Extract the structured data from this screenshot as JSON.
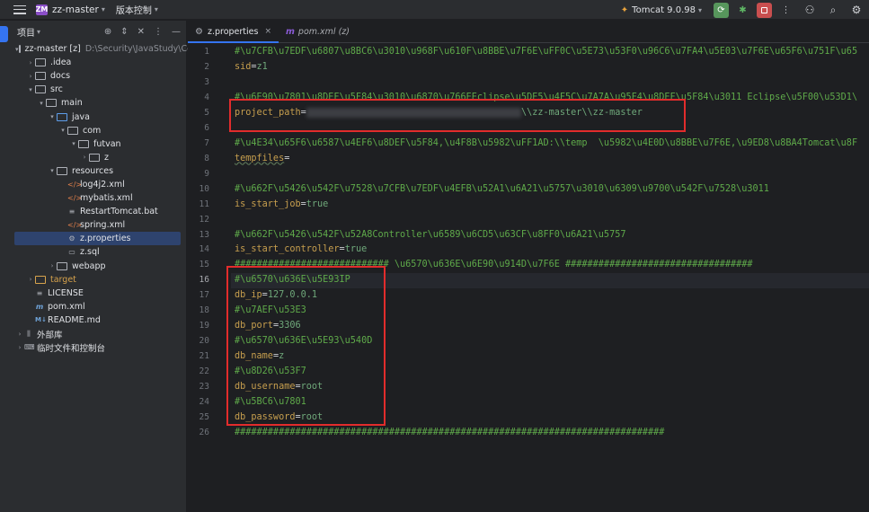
{
  "titlebar": {
    "project_badge": "ZM",
    "project_name": "zz-master",
    "vcs_label": "版本控制",
    "run_config": "Tomcat 9.0.98",
    "icons": [
      "menu-icon",
      "run-icon",
      "debug-icon",
      "stop-icon",
      "more-icon",
      "add-user-icon",
      "search-icon",
      "settings-icon"
    ]
  },
  "project_panel": {
    "title": "项目",
    "tree": [
      {
        "label": "zz-master [z]",
        "extra": "D:\\Security\\JavaStudy\\Code"
      },
      {
        "label": ".idea"
      },
      {
        "label": "docs"
      },
      {
        "label": "src"
      },
      {
        "label": "main"
      },
      {
        "label": "java"
      },
      {
        "label": "com"
      },
      {
        "label": "futvan"
      },
      {
        "label": "z"
      },
      {
        "label": "resources"
      },
      {
        "label": "log4j2.xml"
      },
      {
        "label": "mybatis.xml"
      },
      {
        "label": "RestartTomcat.bat"
      },
      {
        "label": "spring.xml"
      },
      {
        "label": "z.properties"
      },
      {
        "label": "z.sql"
      },
      {
        "label": "webapp"
      },
      {
        "label": "target"
      },
      {
        "label": "LICENSE"
      },
      {
        "label": "pom.xml"
      },
      {
        "label": "README.md"
      },
      {
        "label": "外部库"
      },
      {
        "label": "临时文件和控制台"
      }
    ]
  },
  "tabs": [
    {
      "label": "z.properties"
    },
    {
      "label": "pom.xml (z)"
    }
  ],
  "editor": {
    "lines": [
      {
        "n": "1",
        "parts": [
          {
            "t": "#\\u7CFB\\u7EDF\\u6807\\u8BC6\\u3010\\u968F\\u610F\\u8BBE\\u7F6E\\uFF0C\\u5E73\\u53F0\\u96C6\\u7FA4\\u5E03\\u7F6E\\u65F6\\u751F\\u65",
            "c": "cmt"
          }
        ]
      },
      {
        "n": "2",
        "parts": [
          {
            "t": "sid",
            "c": "key"
          },
          {
            "t": "=",
            "c": "eq"
          },
          {
            "t": "z1",
            "c": "val"
          }
        ]
      },
      {
        "n": "3",
        "parts": []
      },
      {
        "n": "4",
        "parts": [
          {
            "t": "#\\u6E90\\u7801\\u8DEF\\u5F84\\u3010\\u6870\\u766EEclipse\\u5DE5\\u4F5C\\u7A7A\\u95F4\\u8DEF\\u5F84\\u3011 Eclipse\\u5F00\\u53D1\\",
            "c": "cmt"
          }
        ]
      },
      {
        "n": "5",
        "parts": [
          {
            "t": "project_path",
            "c": "key"
          },
          {
            "t": "=",
            "c": "eq"
          },
          {
            "t": "D:\\\\Security\\\\JavaStudy\\\\Code_audit\\\\zz",
            "c": "blur"
          },
          {
            "t": "\\\\zz-master\\\\zz-master",
            "c": "val"
          }
        ]
      },
      {
        "n": "6",
        "parts": []
      },
      {
        "n": "7",
        "parts": [
          {
            "t": "#\\u4E34\\u65F6\\u6587\\u4EF6\\u8DEF\\u5F84,\\u4F8B\\u5982\\uFF1AD:\\\\temp  \\u5982\\u4E0D\\u8BBE\\u7F6E,\\u9ED8\\u8BA4Tomcat\\u8F",
            "c": "cmt"
          }
        ]
      },
      {
        "n": "8",
        "parts": [
          {
            "t": "tempfiles",
            "c": "key spell"
          },
          {
            "t": "=",
            "c": "eq"
          }
        ]
      },
      {
        "n": "9",
        "parts": []
      },
      {
        "n": "10",
        "parts": [
          {
            "t": "#\\u662F\\u5426\\u542F\\u7528\\u7CFB\\u7EDF\\u4EFB\\u52A1\\u6A21\\u5757\\u3010\\u6309\\u9700\\u542F\\u7528\\u3011",
            "c": "cmt"
          }
        ]
      },
      {
        "n": "11",
        "parts": [
          {
            "t": "is_start_job",
            "c": "key"
          },
          {
            "t": "=",
            "c": "eq"
          },
          {
            "t": "true",
            "c": "val"
          }
        ]
      },
      {
        "n": "12",
        "parts": []
      },
      {
        "n": "13",
        "parts": [
          {
            "t": "#\\u662F\\u5426\\u542F\\u52A8Controller\\u6589\\u6CD5\\u63CF\\u8FF0\\u6A21\\u5757",
            "c": "cmt"
          }
        ]
      },
      {
        "n": "14",
        "parts": [
          {
            "t": "is_start_controller",
            "c": "key"
          },
          {
            "t": "=",
            "c": "eq"
          },
          {
            "t": "true",
            "c": "val"
          }
        ]
      },
      {
        "n": "15",
        "parts": [
          {
            "t": "############################ \\u6570\\u636E\\u6E90\\u914D\\u7F6E ##################################",
            "c": "cmt"
          }
        ]
      },
      {
        "n": "16",
        "parts": [
          {
            "t": "#\\u6570\\u636E\\u5E93IP",
            "c": "cmt"
          }
        ]
      },
      {
        "n": "17",
        "parts": [
          {
            "t": "db_ip",
            "c": "key"
          },
          {
            "t": "=",
            "c": "eq"
          },
          {
            "t": "127.0.0.1",
            "c": "val"
          }
        ]
      },
      {
        "n": "18",
        "parts": [
          {
            "t": "#\\u7AEF\\u53E3",
            "c": "cmt"
          }
        ]
      },
      {
        "n": "19",
        "parts": [
          {
            "t": "db_port",
            "c": "key"
          },
          {
            "t": "=",
            "c": "eq"
          },
          {
            "t": "3306",
            "c": "val"
          }
        ]
      },
      {
        "n": "20",
        "parts": [
          {
            "t": "#\\u6570\\u636E\\u5E93\\u540D",
            "c": "cmt"
          }
        ]
      },
      {
        "n": "21",
        "parts": [
          {
            "t": "db_name",
            "c": "key"
          },
          {
            "t": "=",
            "c": "eq"
          },
          {
            "t": "z",
            "c": "val"
          }
        ]
      },
      {
        "n": "22",
        "parts": [
          {
            "t": "#\\u8D26\\u53F7",
            "c": "cmt"
          }
        ]
      },
      {
        "n": "23",
        "parts": [
          {
            "t": "db_username",
            "c": "key"
          },
          {
            "t": "=",
            "c": "eq"
          },
          {
            "t": "root",
            "c": "val"
          }
        ]
      },
      {
        "n": "24",
        "parts": [
          {
            "t": "#\\u5BC6\\u7801",
            "c": "cmt"
          }
        ]
      },
      {
        "n": "25",
        "parts": [
          {
            "t": "db_password",
            "c": "key"
          },
          {
            "t": "=",
            "c": "eq"
          },
          {
            "t": "root",
            "c": "val"
          }
        ]
      },
      {
        "n": "26",
        "parts": [
          {
            "t": "##############################################################################",
            "c": "cmt"
          }
        ]
      }
    ]
  },
  "colors": {
    "accent": "#3574f0",
    "highlight_box": "#e22c2c",
    "comment": "#5faa4a",
    "key": "#c79f4e",
    "value": "#6fa87a"
  }
}
